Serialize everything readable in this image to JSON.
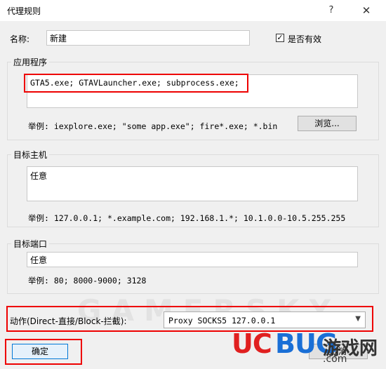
{
  "window": {
    "title": "代理规则",
    "help_glyph": "?",
    "close_glyph": "✕"
  },
  "name_row": {
    "label": "名称:",
    "value": "新建",
    "enabled_label": "是否有效",
    "enabled_checked": true
  },
  "applications": {
    "group_title": "应用程序",
    "value": "GTA5.exe; GTAVLauncher.exe; subprocess.exe;",
    "example": "举例: iexplore.exe; \"some app.exe\"; fire*.exe; *.bin",
    "browse_label": "浏览..."
  },
  "target_hosts": {
    "group_title": "目标主机",
    "value": "任意",
    "example": "举例: 127.0.0.1; *.example.com; 192.168.1.*; 10.1.0.0-10.5.255.255"
  },
  "target_ports": {
    "group_title": "目标端口",
    "value": "任意",
    "example": "举例: 80; 8000-9000; 3128"
  },
  "action": {
    "label": "动作(Direct-直接/Block-拦截):",
    "selected": "Proxy SOCKS5 127.0.0.1"
  },
  "footer": {
    "ok_label": "确定",
    "cancel_label": "取消"
  },
  "watermark": {
    "text": "GAMERSKY"
  },
  "logo": {
    "uc": "UC",
    "bug": "BUG",
    "cn": "游戏网",
    "com": ".com"
  },
  "colors": {
    "highlight_red": "#e00000",
    "accent_blue": "#0078d7"
  }
}
